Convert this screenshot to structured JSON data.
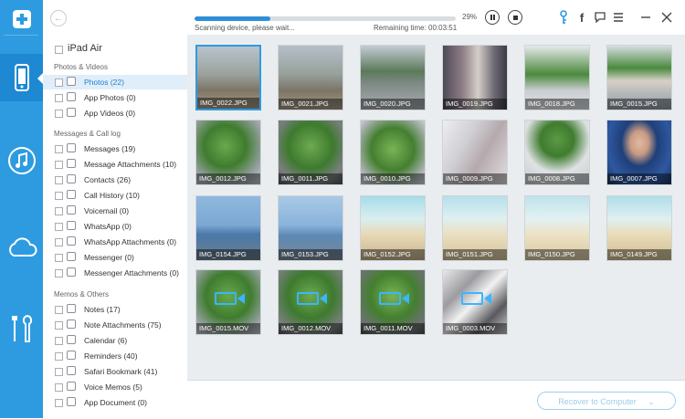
{
  "topbar": {
    "progress_fraction": 0.29,
    "percent": "29%",
    "status": "Scanning device, please wait...",
    "remaining": "Remaining time: 00:03:51"
  },
  "sidebar": {
    "device": "iPad Air",
    "sections": [
      {
        "title": "Photos & Videos",
        "items": [
          "Photos (22)",
          "App Photos (0)",
          "App Videos (0)"
        ]
      },
      {
        "title": "Messages & Call log",
        "items": [
          "Messages (19)",
          "Message Attachments (10)",
          "Contacts (26)",
          "Call History (10)",
          "Voicemail (0)",
          "WhatsApp (0)",
          "WhatsApp Attachments (0)",
          "Messenger (0)",
          "Messenger Attachments (0)"
        ]
      },
      {
        "title": "Memos & Others",
        "items": [
          "Notes (17)",
          "Note Attachments (75)",
          "Calendar (6)",
          "Reminders (40)",
          "Safari Bookmark (41)",
          "Voice Memos (5)",
          "App Document (0)"
        ]
      }
    ]
  },
  "thumbs": [
    "IMG_0022.JPG",
    "IMG_0021.JPG",
    "IMG_0020.JPG",
    "IMG_0019.JPG",
    "IMG_0018.JPG",
    "IMG_0015.JPG",
    "IMG_0012.JPG",
    "IMG_0011.JPG",
    "IMG_0010.JPG",
    "IMG_0009.JPG",
    "IMG_0008.JPG",
    "IMG_0007.JPG",
    "IMG_0154.JPG",
    "IMG_0153.JPG",
    "IMG_0152.JPG",
    "IMG_0151.JPG",
    "IMG_0150.JPG",
    "IMG_0149.JPG",
    "IMG_0015.MOV",
    "IMG_0012.MOV",
    "IMG_0011.MOV",
    "IMG_0003.MOV"
  ],
  "footer": {
    "recover_label": "Recover to Computer"
  },
  "colors": {
    "accent": "#2e9be0",
    "selection": "#e0eefa"
  }
}
